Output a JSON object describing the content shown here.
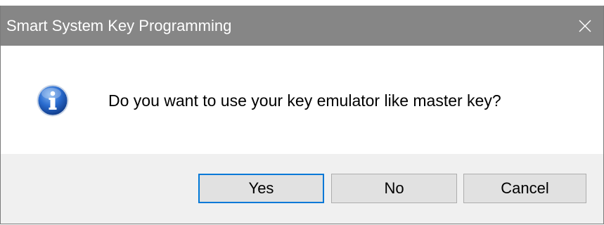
{
  "window": {
    "title": "Smart System Key Programming",
    "close_icon": "close-icon"
  },
  "message": {
    "icon": "info-icon",
    "text": "Do you want to use your key emulator like master key?"
  },
  "buttons": {
    "yes": "Yes",
    "no": "No",
    "cancel": "Cancel"
  },
  "colors": {
    "titlebar": "#868686",
    "button_bar": "#f0f0f0",
    "default_button_border": "#0078d7"
  }
}
